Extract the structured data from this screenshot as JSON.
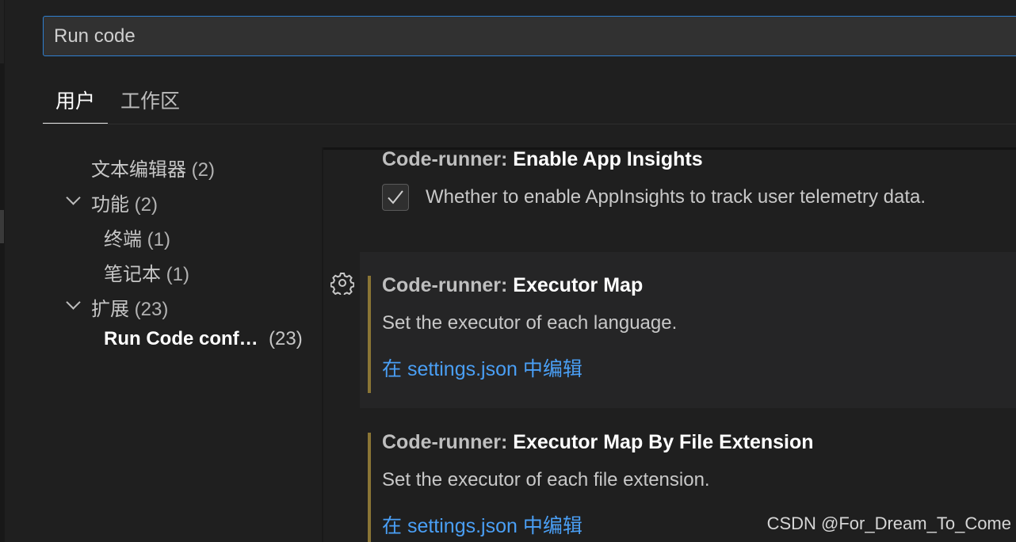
{
  "search": {
    "value": "Run code"
  },
  "tabs": [
    {
      "label": "用户",
      "active": true
    },
    {
      "label": "工作区",
      "active": false
    }
  ],
  "toc": {
    "items": [
      {
        "label": "文本编辑器",
        "count": "(2)"
      },
      {
        "label": "功能",
        "count": "(2)",
        "expanded": true
      },
      {
        "label": "终端",
        "count": "(1)"
      },
      {
        "label": "笔记本",
        "count": "(1)"
      },
      {
        "label": "扩展",
        "count": "(23)",
        "expanded": true
      },
      {
        "label": "Run Code conf…",
        "count": "(23)",
        "selected": true
      }
    ]
  },
  "settings": [
    {
      "category": "Code-runner: ",
      "name": "Enable App Insights",
      "description": "Whether to enable AppInsights to track user telemetry data.",
      "checked": true
    },
    {
      "category": "Code-runner: ",
      "name": "Executor Map",
      "description": "Set the executor of each language.",
      "link": "在 settings.json 中编辑",
      "modified": true
    },
    {
      "category": "Code-runner: ",
      "name": "Executor Map By File Extension",
      "description": "Set the executor of each file extension.",
      "link": "在 settings.json 中编辑",
      "modified": true
    }
  ],
  "icons": {
    "gear": "gear-icon",
    "check": "check-icon",
    "chevron": "chevron-down-icon"
  },
  "colors": {
    "accent": "#2f7fd0",
    "link": "#4a9ff5",
    "modified_bar": "#8a7535"
  },
  "watermark": "CSDN @For_Dream_To_Come"
}
